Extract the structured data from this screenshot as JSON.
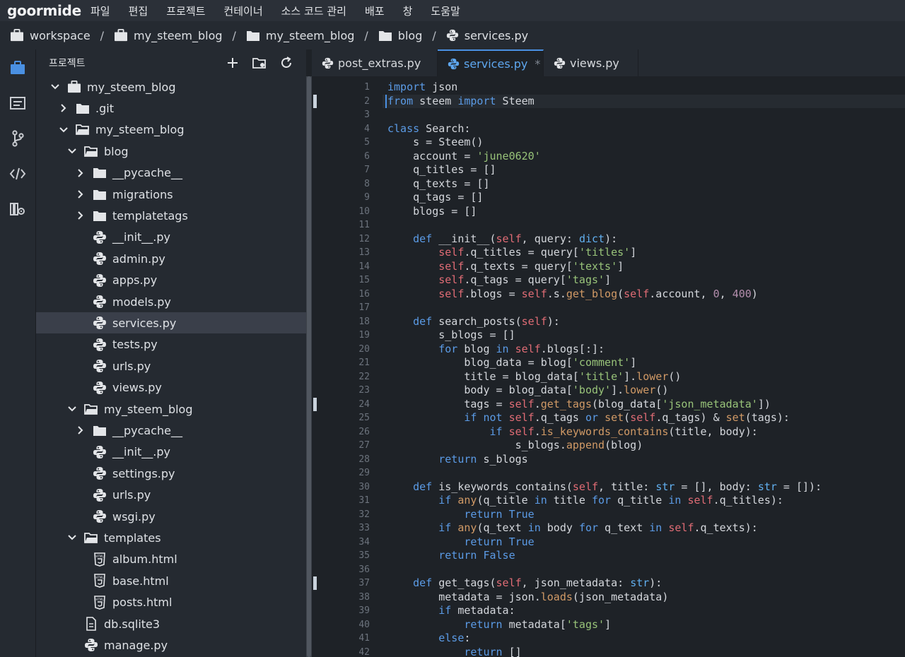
{
  "app": {
    "logo": "goormide"
  },
  "menu": [
    "파일",
    "편집",
    "프로젝트",
    "컨테이너",
    "소스 코드 관리",
    "배포",
    "창",
    "도움말"
  ],
  "breadcrumb": [
    "workspace",
    "my_steem_blog",
    "my_steem_blog",
    "blog",
    "services.py"
  ],
  "sidebar": {
    "title": "프로젝트",
    "tools": [
      "plus-icon",
      "new-folder-icon",
      "refresh-icon"
    ],
    "tree": [
      {
        "label": "my_steem_blog",
        "depth": 0,
        "type": "root",
        "expanded": true
      },
      {
        "label": ".git",
        "depth": 1,
        "type": "folder",
        "expanded": false
      },
      {
        "label": "my_steem_blog",
        "depth": 1,
        "type": "folder",
        "expanded": true
      },
      {
        "label": "blog",
        "depth": 2,
        "type": "folder",
        "expanded": true
      },
      {
        "label": "__pycache__",
        "depth": 3,
        "type": "folder",
        "expanded": false
      },
      {
        "label": "migrations",
        "depth": 3,
        "type": "folder",
        "expanded": false
      },
      {
        "label": "templatetags",
        "depth": 3,
        "type": "folder",
        "expanded": false
      },
      {
        "label": "__init__.py",
        "depth": 3,
        "type": "python"
      },
      {
        "label": "admin.py",
        "depth": 3,
        "type": "python"
      },
      {
        "label": "apps.py",
        "depth": 3,
        "type": "python"
      },
      {
        "label": "models.py",
        "depth": 3,
        "type": "python"
      },
      {
        "label": "services.py",
        "depth": 3,
        "type": "python",
        "selected": true
      },
      {
        "label": "tests.py",
        "depth": 3,
        "type": "python"
      },
      {
        "label": "urls.py",
        "depth": 3,
        "type": "python"
      },
      {
        "label": "views.py",
        "depth": 3,
        "type": "python"
      },
      {
        "label": "my_steem_blog",
        "depth": 2,
        "type": "folder",
        "expanded": true
      },
      {
        "label": "__pycache__",
        "depth": 3,
        "type": "folder",
        "expanded": false
      },
      {
        "label": "__init__.py",
        "depth": 3,
        "type": "python"
      },
      {
        "label": "settings.py",
        "depth": 3,
        "type": "python"
      },
      {
        "label": "urls.py",
        "depth": 3,
        "type": "python"
      },
      {
        "label": "wsgi.py",
        "depth": 3,
        "type": "python"
      },
      {
        "label": "templates",
        "depth": 2,
        "type": "folder",
        "expanded": true
      },
      {
        "label": "album.html",
        "depth": 3,
        "type": "html"
      },
      {
        "label": "base.html",
        "depth": 3,
        "type": "html"
      },
      {
        "label": "posts.html",
        "depth": 3,
        "type": "html"
      },
      {
        "label": "db.sqlite3",
        "depth": 2,
        "type": "file"
      },
      {
        "label": "manage.py",
        "depth": 2,
        "type": "python"
      }
    ]
  },
  "tabs": [
    {
      "label": "post_extras.py",
      "active": false
    },
    {
      "label": "services.py",
      "active": true,
      "modified": "*"
    },
    {
      "label": "views.py",
      "active": false
    }
  ],
  "editor": {
    "cursor_line": 2,
    "marked_lines": [
      2,
      24,
      37
    ],
    "lines": [
      [
        [
          "import",
          "kw"
        ],
        [
          " json",
          ""
        ]
      ],
      [
        [
          "from",
          "kw"
        ],
        [
          " steem ",
          ""
        ],
        [
          "import",
          "kw"
        ],
        [
          " Steem",
          ""
        ]
      ],
      [],
      [
        [
          "class",
          "kw"
        ],
        [
          " Search:",
          ""
        ]
      ],
      [
        [
          "    s = Steem()",
          ""
        ]
      ],
      [
        [
          "    account = ",
          ""
        ],
        [
          "'june0620'",
          "st"
        ]
      ],
      [
        [
          "    q_titles = []",
          ""
        ]
      ],
      [
        [
          "    q_texts = []",
          ""
        ]
      ],
      [
        [
          "    q_tags = []",
          ""
        ]
      ],
      [
        [
          "    blogs = []",
          ""
        ]
      ],
      [],
      [
        [
          "    ",
          ""
        ],
        [
          "def",
          "kw"
        ],
        [
          " __init__(",
          ""
        ],
        [
          "self",
          "sf"
        ],
        [
          ", query: ",
          ""
        ],
        [
          "dict",
          "ty"
        ],
        [
          "):",
          ""
        ]
      ],
      [
        [
          "        ",
          ""
        ],
        [
          "self",
          "sf"
        ],
        [
          ".q_titles = query[",
          ""
        ],
        [
          "'titles'",
          "st"
        ],
        [
          "]",
          ""
        ]
      ],
      [
        [
          "        ",
          ""
        ],
        [
          "self",
          "sf"
        ],
        [
          ".q_texts = query[",
          ""
        ],
        [
          "'texts'",
          "st"
        ],
        [
          "]",
          ""
        ]
      ],
      [
        [
          "        ",
          ""
        ],
        [
          "self",
          "sf"
        ],
        [
          ".q_tags = query[",
          ""
        ],
        [
          "'tags'",
          "st"
        ],
        [
          "]",
          ""
        ]
      ],
      [
        [
          "        ",
          ""
        ],
        [
          "self",
          "sf"
        ],
        [
          ".blogs = ",
          ""
        ],
        [
          "self",
          "sf"
        ],
        [
          ".s.",
          ""
        ],
        [
          "get_blog",
          "fn"
        ],
        [
          "(",
          ""
        ],
        [
          "self",
          "sf"
        ],
        [
          ".account, ",
          ""
        ],
        [
          "0",
          "nm"
        ],
        [
          ", ",
          ""
        ],
        [
          "400",
          "nm"
        ],
        [
          ")",
          ""
        ]
      ],
      [],
      [
        [
          "    ",
          ""
        ],
        [
          "def",
          "kw"
        ],
        [
          " search_posts(",
          ""
        ],
        [
          "self",
          "sf"
        ],
        [
          "):",
          ""
        ]
      ],
      [
        [
          "        s_blogs = []",
          ""
        ]
      ],
      [
        [
          "        ",
          ""
        ],
        [
          "for",
          "kw"
        ],
        [
          " blog ",
          ""
        ],
        [
          "in",
          "kw"
        ],
        [
          " ",
          ""
        ],
        [
          "self",
          "sf"
        ],
        [
          ".blogs[:]:",
          ""
        ]
      ],
      [
        [
          "            blog_data = blog[",
          ""
        ],
        [
          "'comment'",
          "st"
        ],
        [
          "]",
          ""
        ]
      ],
      [
        [
          "            title = blog_data[",
          ""
        ],
        [
          "'title'",
          "st"
        ],
        [
          "].",
          ""
        ],
        [
          "lower",
          "fn"
        ],
        [
          "()",
          ""
        ]
      ],
      [
        [
          "            body = blog_data[",
          ""
        ],
        [
          "'body'",
          "st"
        ],
        [
          "].",
          ""
        ],
        [
          "lower",
          "fn"
        ],
        [
          "()",
          ""
        ]
      ],
      [
        [
          "            tags = ",
          ""
        ],
        [
          "self",
          "sf"
        ],
        [
          ".",
          ""
        ],
        [
          "get_tags",
          "fn"
        ],
        [
          "(blog_data[",
          ""
        ],
        [
          "'json_metadata'",
          "st"
        ],
        [
          "])",
          ""
        ]
      ],
      [
        [
          "            ",
          ""
        ],
        [
          "if",
          "kw"
        ],
        [
          " ",
          ""
        ],
        [
          "not",
          "kw"
        ],
        [
          " ",
          ""
        ],
        [
          "self",
          "sf"
        ],
        [
          ".q_tags ",
          ""
        ],
        [
          "or",
          "kw"
        ],
        [
          " ",
          ""
        ],
        [
          "set",
          "fn"
        ],
        [
          "(",
          ""
        ],
        [
          "self",
          "sf"
        ],
        [
          ".q_tags) & ",
          ""
        ],
        [
          "set",
          "fn"
        ],
        [
          "(tags):",
          ""
        ]
      ],
      [
        [
          "                ",
          ""
        ],
        [
          "if",
          "kw"
        ],
        [
          " ",
          ""
        ],
        [
          "self",
          "sf"
        ],
        [
          ".",
          ""
        ],
        [
          "is_keywords_contains",
          "fn"
        ],
        [
          "(title, body):",
          ""
        ]
      ],
      [
        [
          "                    s_blogs.",
          ""
        ],
        [
          "append",
          "fn"
        ],
        [
          "(blog)",
          ""
        ]
      ],
      [
        [
          "        ",
          ""
        ],
        [
          "return",
          "kw"
        ],
        [
          " s_blogs",
          ""
        ]
      ],
      [],
      [
        [
          "    ",
          ""
        ],
        [
          "def",
          "kw"
        ],
        [
          " is_keywords_contains(",
          ""
        ],
        [
          "self",
          "sf"
        ],
        [
          ", title: ",
          ""
        ],
        [
          "str",
          "ty"
        ],
        [
          " = [], body: ",
          ""
        ],
        [
          "str",
          "ty"
        ],
        [
          " = []):",
          ""
        ]
      ],
      [
        [
          "        ",
          ""
        ],
        [
          "if",
          "kw"
        ],
        [
          " ",
          ""
        ],
        [
          "any",
          "fn"
        ],
        [
          "(q_title ",
          ""
        ],
        [
          "in",
          "kw"
        ],
        [
          " title ",
          ""
        ],
        [
          "for",
          "kw"
        ],
        [
          " q_title ",
          ""
        ],
        [
          "in",
          "kw"
        ],
        [
          " ",
          ""
        ],
        [
          "self",
          "sf"
        ],
        [
          ".q_titles):",
          ""
        ]
      ],
      [
        [
          "            ",
          ""
        ],
        [
          "return",
          "kw"
        ],
        [
          " ",
          ""
        ],
        [
          "True",
          "kw"
        ]
      ],
      [
        [
          "        ",
          ""
        ],
        [
          "if",
          "kw"
        ],
        [
          " ",
          ""
        ],
        [
          "any",
          "fn"
        ],
        [
          "(q_text ",
          ""
        ],
        [
          "in",
          "kw"
        ],
        [
          " body ",
          ""
        ],
        [
          "for",
          "kw"
        ],
        [
          " q_text ",
          ""
        ],
        [
          "in",
          "kw"
        ],
        [
          " ",
          ""
        ],
        [
          "self",
          "sf"
        ],
        [
          ".q_texts):",
          ""
        ]
      ],
      [
        [
          "            ",
          ""
        ],
        [
          "return",
          "kw"
        ],
        [
          " ",
          ""
        ],
        [
          "True",
          "kw"
        ]
      ],
      [
        [
          "        ",
          ""
        ],
        [
          "return",
          "kw"
        ],
        [
          " ",
          ""
        ],
        [
          "False",
          "kw"
        ]
      ],
      [],
      [
        [
          "    ",
          ""
        ],
        [
          "def",
          "kw"
        ],
        [
          " get_tags(",
          ""
        ],
        [
          "self",
          "sf"
        ],
        [
          ", json_metadata: ",
          ""
        ],
        [
          "str",
          "ty"
        ],
        [
          "):",
          ""
        ]
      ],
      [
        [
          "        metadata = json.",
          ""
        ],
        [
          "loads",
          "fn"
        ],
        [
          "(json_metadata)",
          ""
        ]
      ],
      [
        [
          "        ",
          ""
        ],
        [
          "if",
          "kw"
        ],
        [
          " metadata:",
          ""
        ]
      ],
      [
        [
          "            ",
          ""
        ],
        [
          "return",
          "kw"
        ],
        [
          " metadata[",
          ""
        ],
        [
          "'tags'",
          "st"
        ],
        [
          "]",
          ""
        ]
      ],
      [
        [
          "        ",
          ""
        ],
        [
          "else",
          "kw"
        ],
        [
          ":",
          ""
        ]
      ],
      [
        [
          "            ",
          ""
        ],
        [
          "return",
          "kw"
        ],
        [
          " []",
          ""
        ]
      ]
    ]
  },
  "colors": {
    "menubar": "#2b3038",
    "panel": "#252a31",
    "editor": "#1e2227",
    "accent": "#4a90e2",
    "selected_row": "#3a3f4a"
  }
}
